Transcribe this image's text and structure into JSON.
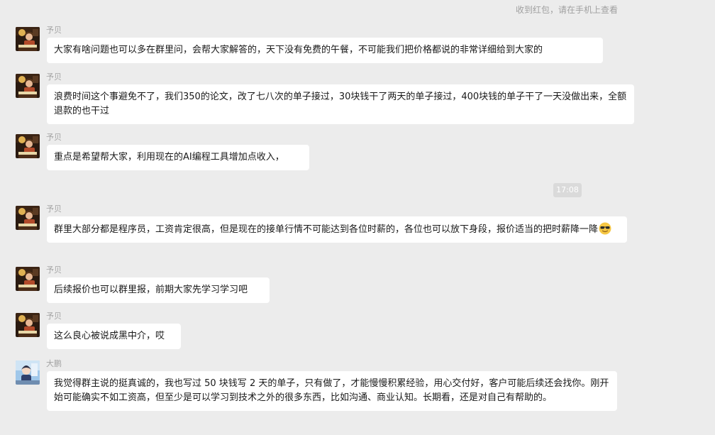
{
  "system_note": "收到红包，请在手机上查看",
  "timestamp": "17:08",
  "messages": [
    {
      "sender": "予贝",
      "avatar": "night-reading-icon",
      "text": "大家有啥问题也可以多在群里问，会帮大家解答的，天下没有免费的午餐，不可能我们把价格都说的非常详细给到大家的"
    },
    {
      "sender": "予贝",
      "avatar": "night-reading-icon",
      "text": "浪费时间这个事避免不了，我们350的论文，改了七八次的单子接过，30块钱干了两天的单子接过，400块钱的单子干了一天没做出来，全额退款的也干过"
    },
    {
      "sender": "予贝",
      "avatar": "night-reading-icon",
      "text": "重点是希望帮大家，利用现在的AI编程工具增加点收入，"
    },
    {
      "sender": "予贝",
      "avatar": "night-reading-icon",
      "text": "群里大部分都是程序员，工资肯定很高，但是现在的接单行情不可能达到各位时薪的，各位也可以放下身段，报价适当的把时薪降一降",
      "emoji": "cool-sunglasses-emoji"
    },
    {
      "sender": "予贝",
      "avatar": "night-reading-icon",
      "text": "后续报价也可以群里报，前期大家先学习学习吧"
    },
    {
      "sender": "予贝",
      "avatar": "night-reading-icon",
      "text": "这么良心被说成黑中介，哎"
    },
    {
      "sender": "大鹏",
      "avatar": "anime-boy-icon",
      "text": "我觉得群主说的挺真诚的，我也写过 50 块钱写 2 天的单子，只有做了，才能慢慢积累经验，用心交付好，客户可能后续还会找你。刚开始可能确实不如工资高，但至少是可以学习到技术之外的很多东西，比如沟通、商业认知。长期看，还是对自己有帮助的。"
    }
  ],
  "colors": {
    "background": "#ececec",
    "bubble": "#ffffff",
    "name": "#a3a3a3",
    "timestamp_bg": "#dadada"
  }
}
